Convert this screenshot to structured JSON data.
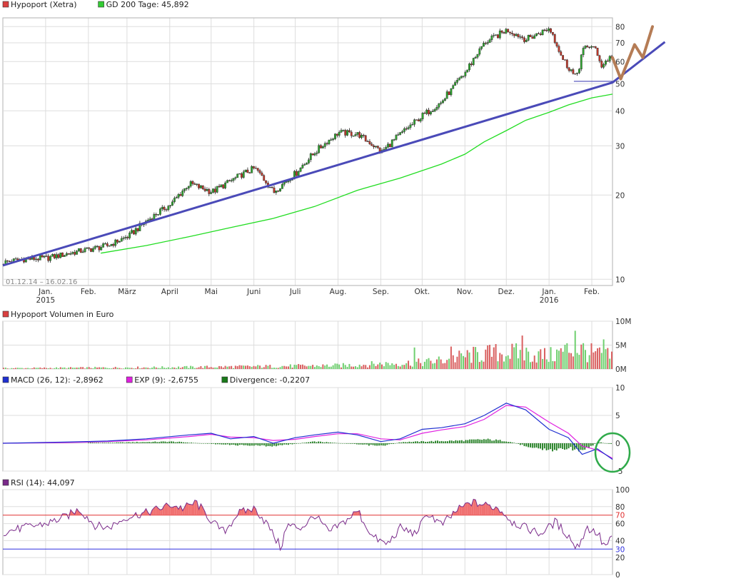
{
  "colors": {
    "grid": "#dddddd",
    "frame": "#b0b0b0",
    "price_bull": "#2fa52f",
    "price_bear": "#c0392b",
    "gd200": "#22dd22",
    "trend": "#4a4ab8",
    "annotation": "#b57c55",
    "volume_up": "#6fcf6f",
    "volume_down": "#d96060",
    "macd": "#1f2fd0",
    "exp": "#e020e0",
    "divergence": "#1a7a1a",
    "rsi": "#7a2a8a",
    "rsi_fill": "#f07070",
    "rsi_70": "#e03030",
    "rsi_30": "#3030e0",
    "circle": "#2faa4a"
  },
  "chart_data": [
    {
      "type": "candlestick",
      "legend": [
        {
          "name": "Hypoport (Xetra)",
          "color": "#d94040"
        },
        {
          "name": "GD 200 Tage: 45,892",
          "color": "#33cc33"
        }
      ],
      "date_range_label": "01.12.14 – 16.02.16",
      "x_labels": [
        "Jan.",
        "Feb.",
        "März",
        "April",
        "Mai",
        "Juni",
        "Juli",
        "Aug.",
        "Sep.",
        "Okt.",
        "Nov.",
        "Dez.",
        "Jan.",
        "Feb."
      ],
      "x_label_dates": [
        "2015-01-01",
        "2015-02-01",
        "2015-03-01",
        "2015-04-01",
        "2015-05-01",
        "2015-06-01",
        "2015-07-01",
        "2015-08-01",
        "2015-09-01",
        "2015-10-01",
        "2015-11-01",
        "2015-12-01",
        "2016-01-01",
        "2016-02-01"
      ],
      "year_labels": [
        {
          "label": "2015",
          "date": "2015-01-01"
        },
        {
          "label": "2016",
          "date": "2016-01-01"
        }
      ],
      "x_range": [
        "2014-12-01",
        "2016-02-16"
      ],
      "y_scale": "log",
      "ylim": [
        9.5,
        86
      ],
      "y_ticks": [
        10,
        20,
        30,
        40,
        50,
        60,
        70,
        80
      ],
      "y_tick_labels": [
        "10",
        "20",
        "30",
        "40",
        "50",
        "60",
        "70",
        "80"
      ],
      "price": {
        "dates": [
          "2014-12-01",
          "2014-12-15",
          "2015-01-01",
          "2015-01-15",
          "2015-02-01",
          "2015-02-15",
          "2015-03-01",
          "2015-03-15",
          "2015-04-01",
          "2015-04-15",
          "2015-05-01",
          "2015-05-15",
          "2015-06-01",
          "2015-06-15",
          "2015-07-01",
          "2015-07-15",
          "2015-08-01",
          "2015-08-15",
          "2015-09-01",
          "2015-09-15",
          "2015-10-01",
          "2015-10-15",
          "2015-11-01",
          "2015-11-15",
          "2015-12-01",
          "2015-12-15",
          "2016-01-01",
          "2016-01-10",
          "2016-01-20",
          "2016-01-25",
          "2016-02-01",
          "2016-02-08",
          "2016-02-12",
          "2016-02-16"
        ],
        "close": [
          11.5,
          11.8,
          11.9,
          12.3,
          12.8,
          13.2,
          14.2,
          16.2,
          18.5,
          22.0,
          20.5,
          22.5,
          25.0,
          20.5,
          24.0,
          28.5,
          33.5,
          33.0,
          28.5,
          33.0,
          38.5,
          43.0,
          55.0,
          70.0,
          78.0,
          72.0,
          79.0,
          62.0,
          52.0,
          66.0,
          69.0,
          58.0,
          61.0,
          63.0
        ]
      },
      "gd200": {
        "dates": [
          "2015-02-10",
          "2015-03-15",
          "2015-04-15",
          "2015-05-15",
          "2015-06-15",
          "2015-07-15",
          "2015-08-15",
          "2015-09-15",
          "2015-10-15",
          "2015-11-01",
          "2015-11-15",
          "2015-12-01",
          "2015-12-15",
          "2016-01-01",
          "2016-01-15",
          "2016-02-01",
          "2016-02-16"
        ],
        "values": [
          12.4,
          13.2,
          14.2,
          15.3,
          16.5,
          18.2,
          20.8,
          23.0,
          25.8,
          28.0,
          31.0,
          34.0,
          37.0,
          39.5,
          42.0,
          44.5,
          45.9
        ]
      },
      "trendline": [
        {
          "date": "2014-12-01",
          "value": 11.2
        },
        {
          "date": "2016-02-16",
          "value": 50.5
        },
        {
          "date": "2016-03-25",
          "value": 70.5
        }
      ],
      "support_line": {
        "from": "2016-01-19",
        "to": "2016-02-16",
        "value": 51.0
      },
      "annotation_path": [
        {
          "date": "2016-02-16",
          "value": 62
        },
        {
          "date": "2016-02-22",
          "value": 52
        },
        {
          "date": "2016-03-03",
          "value": 69
        },
        {
          "date": "2016-03-09",
          "value": 62
        },
        {
          "date": "2016-03-16",
          "value": 80
        }
      ]
    },
    {
      "type": "bar",
      "legend": [
        {
          "name": "Hypoport Volumen in Euro",
          "color": "#d94040"
        }
      ],
      "y_ticks": [
        0,
        5,
        10
      ],
      "y_tick_labels": [
        "0M",
        "5M",
        "10M"
      ],
      "ylim": [
        0,
        10
      ],
      "y_unit": "M",
      "volume": {
        "dates": [
          "2014-12-01",
          "2015-02-01",
          "2015-04-01",
          "2015-06-01",
          "2015-08-01",
          "2015-09-01",
          "2015-10-01",
          "2015-10-15",
          "2015-11-01",
          "2015-11-15",
          "2015-12-01",
          "2015-12-15",
          "2016-01-01",
          "2016-01-10",
          "2016-01-20",
          "2016-02-01",
          "2016-02-12"
        ],
        "values": [
          0.2,
          0.3,
          0.4,
          0.6,
          0.8,
          1.2,
          1.5,
          2.0,
          3.0,
          3.5,
          3.8,
          3.5,
          3.0,
          4.0,
          5.0,
          3.5,
          3.0
        ]
      },
      "peaks": [
        {
          "date": "2015-09-25",
          "value": 4.5
        },
        {
          "date": "2015-10-22",
          "value": 4.7
        },
        {
          "date": "2015-12-13",
          "value": 7.0
        },
        {
          "date": "2016-01-20",
          "value": 8.0
        },
        {
          "date": "2016-02-10",
          "value": 6.2
        }
      ]
    },
    {
      "type": "line",
      "legend": [
        {
          "name": "MACD (26, 12): -2,8962",
          "color": "#1f2fd0"
        },
        {
          "name": "EXP (9): -2,6755",
          "color": "#e020e0"
        },
        {
          "name": "Divergence: -0,2207",
          "color": "#1a7a1a"
        }
      ],
      "y_ticks": [
        -5,
        0,
        5,
        10
      ],
      "y_tick_labels": [
        "-5",
        "0",
        "5",
        "10"
      ],
      "ylim": [
        -5,
        10
      ],
      "macd": {
        "dates": [
          "2014-12-01",
          "2015-01-15",
          "2015-02-15",
          "2015-03-15",
          "2015-04-15",
          "2015-05-01",
          "2015-05-15",
          "2015-06-01",
          "2015-06-15",
          "2015-07-01",
          "2015-07-15",
          "2015-08-01",
          "2015-08-15",
          "2015-09-01",
          "2015-09-15",
          "2015-10-01",
          "2015-10-15",
          "2015-11-01",
          "2015-11-15",
          "2015-12-01",
          "2015-12-15",
          "2016-01-01",
          "2016-01-15",
          "2016-01-25",
          "2016-02-05",
          "2016-02-16"
        ],
        "values": [
          0.0,
          0.2,
          0.4,
          0.8,
          1.5,
          1.8,
          0.8,
          1.2,
          0.0,
          1.0,
          1.5,
          2.0,
          1.5,
          0.3,
          0.8,
          2.5,
          2.8,
          3.5,
          5.0,
          7.2,
          6.0,
          2.5,
          1.0,
          -2.0,
          -1.0,
          -2.9
        ]
      },
      "exp": {
        "dates": [
          "2014-12-01",
          "2015-01-15",
          "2015-02-15",
          "2015-03-15",
          "2015-04-15",
          "2015-05-01",
          "2015-05-15",
          "2015-06-01",
          "2015-06-15",
          "2015-07-01",
          "2015-07-15",
          "2015-08-01",
          "2015-08-15",
          "2015-09-01",
          "2015-09-15",
          "2015-10-01",
          "2015-10-15",
          "2015-11-01",
          "2015-11-15",
          "2015-12-01",
          "2015-12-15",
          "2016-01-01",
          "2016-01-15",
          "2016-01-25",
          "2016-02-05",
          "2016-02-16"
        ],
        "values": [
          0.0,
          0.1,
          0.3,
          0.6,
          1.2,
          1.6,
          1.1,
          1.0,
          0.5,
          0.7,
          1.2,
          1.7,
          1.7,
          0.8,
          0.6,
          1.8,
          2.4,
          3.0,
          4.3,
          6.8,
          6.5,
          3.8,
          1.8,
          -0.5,
          -1.2,
          -2.7
        ]
      },
      "divergence": {
        "dates": [
          "2015-02-15",
          "2015-04-01",
          "2015-05-15",
          "2015-06-15",
          "2015-07-15",
          "2015-08-15",
          "2015-09-01",
          "2015-09-15",
          "2015-10-15",
          "2015-11-01",
          "2015-11-15",
          "2015-12-01",
          "2015-12-15",
          "2016-01-01",
          "2016-01-15",
          "2016-01-25",
          "2016-02-05",
          "2016-02-16"
        ],
        "values": [
          0.1,
          0.3,
          -0.3,
          -0.5,
          0.3,
          -0.2,
          -0.5,
          0.2,
          0.4,
          0.5,
          0.7,
          0.4,
          -0.5,
          -1.3,
          -0.8,
          -1.5,
          0.2,
          -0.2
        ]
      }
    },
    {
      "type": "line",
      "legend": [
        {
          "name": "RSI (14): 44,097",
          "color": "#7a2a8a"
        }
      ],
      "y_ticks": [
        0,
        20,
        40,
        60,
        80,
        100
      ],
      "y_tick_labels": [
        "0",
        "20",
        "40",
        "60",
        "80",
        "100"
      ],
      "extra_ticks": [
        {
          "value": 70,
          "label": "70",
          "color": "#e03030"
        },
        {
          "value": 30,
          "label": "30",
          "color": "#3030e0"
        }
      ],
      "ylim": [
        0,
        100
      ],
      "rsi": {
        "dates": [
          "2014-12-01",
          "2014-12-15",
          "2015-01-01",
          "2015-01-15",
          "2015-01-25",
          "2015-02-05",
          "2015-02-15",
          "2015-03-01",
          "2015-03-15",
          "2015-04-01",
          "2015-04-10",
          "2015-04-20",
          "2015-05-01",
          "2015-05-10",
          "2015-05-20",
          "2015-06-01",
          "2015-06-10",
          "2015-06-20",
          "2015-06-25",
          "2015-07-05",
          "2015-07-15",
          "2015-07-25",
          "2015-08-05",
          "2015-08-15",
          "2015-08-25",
          "2015-09-05",
          "2015-09-15",
          "2015-09-25",
          "2015-10-05",
          "2015-10-15",
          "2015-10-25",
          "2015-11-05",
          "2015-11-15",
          "2015-11-25",
          "2015-12-05",
          "2015-12-15",
          "2015-12-25",
          "2016-01-05",
          "2016-01-15",
          "2016-01-20",
          "2016-01-28",
          "2016-02-05",
          "2016-02-10",
          "2016-02-16"
        ],
        "values": [
          50,
          55,
          60,
          68,
          77,
          58,
          55,
          68,
          73,
          82,
          78,
          85,
          62,
          50,
          72,
          78,
          60,
          32,
          58,
          55,
          70,
          50,
          62,
          75,
          45,
          35,
          55,
          48,
          72,
          58,
          75,
          85,
          82,
          78,
          62,
          55,
          48,
          62,
          45,
          30,
          55,
          48,
          32,
          44
        ]
      }
    }
  ]
}
